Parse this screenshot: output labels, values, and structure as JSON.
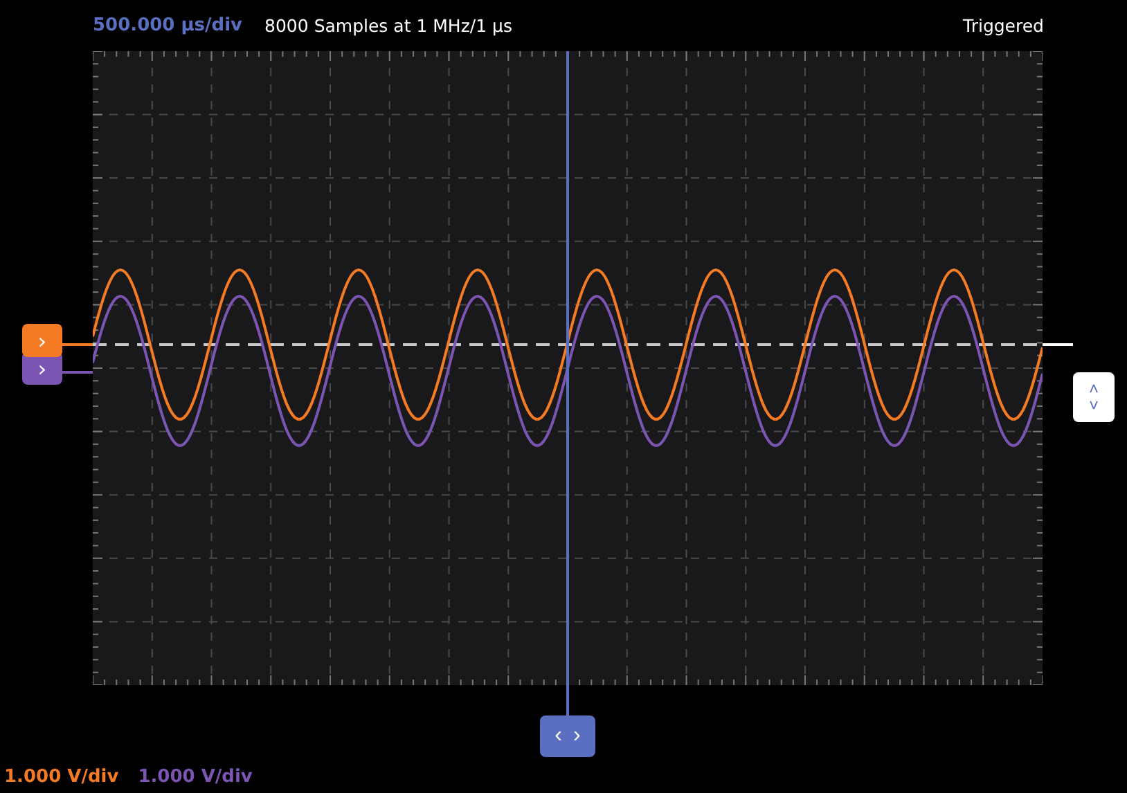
{
  "header": {
    "timebase": "500.000 µs/div",
    "acquisition": "8000 Samples at 1 MHz/1 µs",
    "status": "Triggered"
  },
  "channels": [
    {
      "scale": "1.000 V/div",
      "color": "#f47a24",
      "marker": "›"
    },
    {
      "scale": "1.000 V/div",
      "color": "#7c55b3",
      "marker": "›"
    }
  ],
  "trigger": {
    "up": "˄",
    "down": "˅"
  },
  "cursor": {
    "left": "‹",
    "right": "›"
  }
}
